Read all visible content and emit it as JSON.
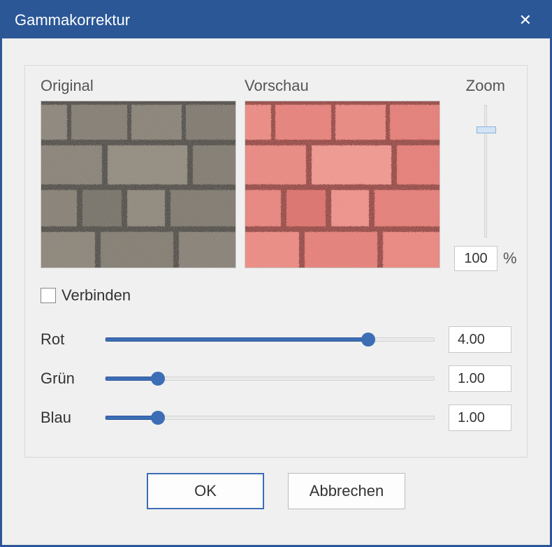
{
  "title": "Gammakorrektur",
  "previews": {
    "original_label": "Original",
    "preview_label": "Vorschau"
  },
  "zoom": {
    "label": "Zoom",
    "value": "100",
    "suffix": "%"
  },
  "link": {
    "label": "Verbinden",
    "checked": false
  },
  "channels": {
    "red": {
      "label": "Rot",
      "value": "4.00",
      "fill_pct": 80
    },
    "green": {
      "label": "Grün",
      "value": "1.00",
      "fill_pct": 16
    },
    "blue": {
      "label": "Blau",
      "value": "1.00",
      "fill_pct": 16
    }
  },
  "buttons": {
    "ok": "OK",
    "cancel": "Abbrechen"
  }
}
